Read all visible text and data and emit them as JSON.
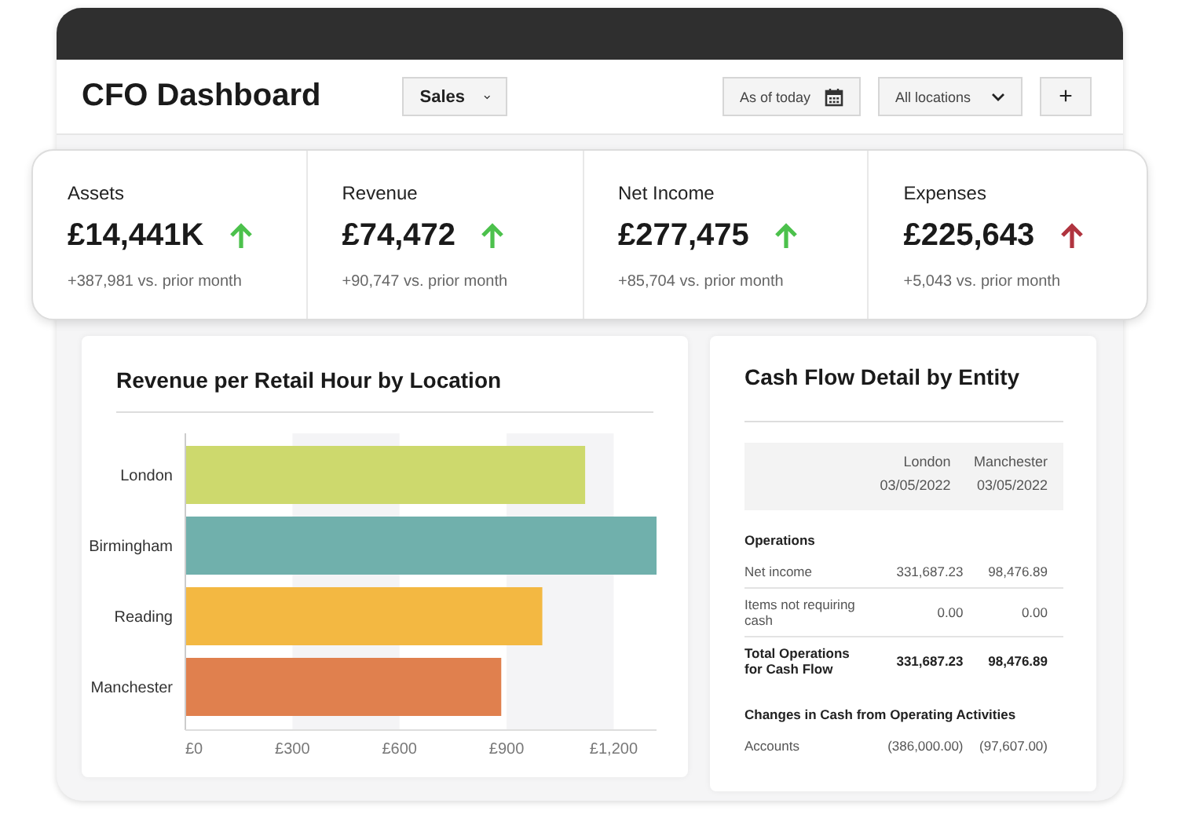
{
  "header": {
    "title": "CFO Dashboard",
    "view_select": "Sales",
    "date_field": "As of today",
    "location_select": "All locations",
    "add_button": "+"
  },
  "kpis": [
    {
      "label": "Assets",
      "value": "£14,441K",
      "color": "#4cc14c",
      "change": "+387,981 vs. prior month"
    },
    {
      "label": "Revenue",
      "value": "£74,472",
      "color": "#4cc14c",
      "change": "+90,747 vs. prior month"
    },
    {
      "label": "Net Income",
      "value": "£277,475",
      "color": "#4cc14c",
      "change": "+85,704 vs. prior month"
    },
    {
      "label": "Expenses",
      "value": "£225,643",
      "color": "#b0343f",
      "change": "+5,043 vs. prior month"
    }
  ],
  "revenue_chart": {
    "title": "Revenue per Retail Hour by Location",
    "chart_data": {
      "type": "bar",
      "orientation": "horizontal",
      "series": [
        {
          "name": "London",
          "color": "#cdd96d",
          "values": [
            1120,
            null,
            null,
            null
          ]
        },
        {
          "name": "Birmingham",
          "color": "#70b0ac",
          "values": [
            null,
            1320,
            null,
            null
          ]
        },
        {
          "name": "Reading",
          "color": "#f3b842",
          "values": [
            null,
            null,
            1000,
            null
          ]
        },
        {
          "name": "Manchester",
          "color": "#e0804e",
          "values": [
            null,
            null,
            null,
            885
          ]
        }
      ],
      "xlim": [
        0,
        1320
      ],
      "xticks": [
        {
          "value": 0,
          "label": "£0"
        },
        {
          "value": 300,
          "label": "£300"
        },
        {
          "value": 600,
          "label": "£600"
        },
        {
          "value": 900,
          "label": "£900"
        },
        {
          "value": 1200,
          "label": "£1,200"
        }
      ]
    }
  },
  "cash_flow": {
    "title": "Cash Flow Detail by Entity",
    "columns": [
      {
        "name": "London",
        "date": "03/05/2022"
      },
      {
        "name": "Manchester",
        "date": "03/05/2022"
      }
    ],
    "rows": [
      {
        "kind": "section",
        "label": "Operations"
      },
      {
        "kind": "line",
        "label": "Net income",
        "values": [
          "331,687.23",
          "98,476.89"
        ]
      },
      {
        "kind": "line",
        "label": "Items not requiring cash",
        "values": [
          "0.00",
          "0.00"
        ]
      },
      {
        "kind": "total",
        "label": "Total Operations for Cash Flow",
        "values": [
          "331,687.23",
          "98,476.89"
        ]
      },
      {
        "kind": "section",
        "label": "Changes in Cash from Operating Activities"
      },
      {
        "kind": "line",
        "label": "Accounts",
        "values": [
          "(386,000.00)",
          "(97,607.00)"
        ]
      }
    ]
  }
}
